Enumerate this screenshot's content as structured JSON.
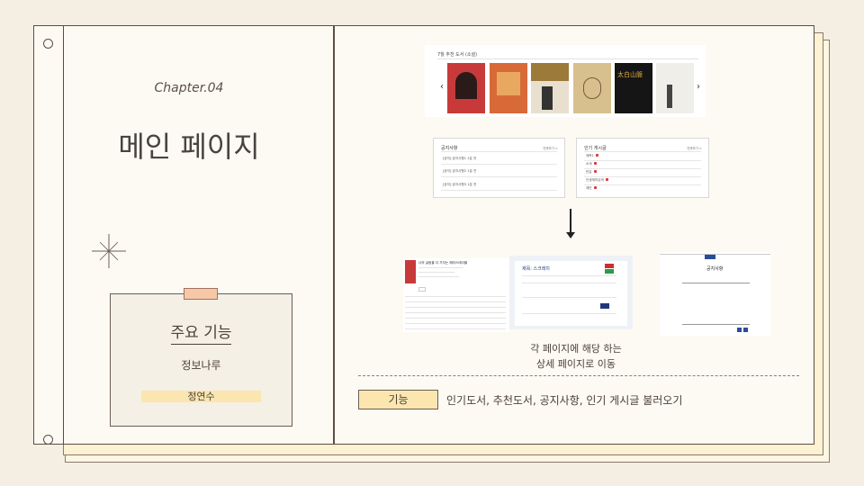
{
  "left_page": {
    "chapter": "Chapter.04",
    "title": "메인 페이지",
    "card": {
      "heading": "주요 기능",
      "subtitle": "정보나루",
      "author": "정연수"
    }
  },
  "right_page": {
    "books_panel": {
      "title": "7월 추천 도서 (소설)",
      "prev": "‹",
      "next": "›",
      "book_cover_text": [
        "",
        "",
        "",
        "",
        "太白山脈",
        ""
      ]
    },
    "notice_panel": {
      "title": "공지사항",
      "more": "전체보기 >",
      "rows": [
        "[공지] 공지사항1  1분 전",
        "[공지] 공지사항2  1분 전",
        "[공지] 공지사항3  1분 전"
      ]
    },
    "popular_panel": {
      "title": "인기 게시글",
      "more": "전체보기 >",
      "rows": [
        "제목1",
        "소개",
        "반갑",
        "인생재미있게",
        "제민"
      ]
    },
    "detail_shots": {
      "book_title": "나의 살림을 다 가지는 해리스테이블",
      "post_title": "제목: 스크래치",
      "post_btn": "",
      "notice_title": "공지사항",
      "notice_tab": "목록"
    },
    "caption_line1": "각 페이지에 해당 하는",
    "caption_line2": "상세 페이지로 이동",
    "feature_label": "기능",
    "feature_desc": "인기도서, 추천도서, 공지사항, 인기 게시글 불러오기"
  },
  "colors": {
    "background": "#f5efe3",
    "paper": "#fdfaf3",
    "highlight": "#fbe6b0",
    "tape": "#f7c8a8",
    "ink": "#4a4038"
  }
}
